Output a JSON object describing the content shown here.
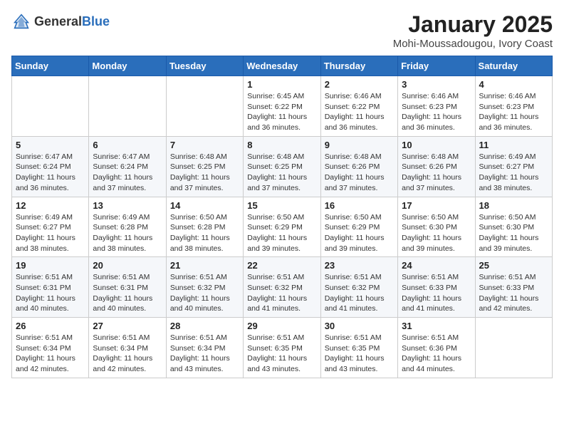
{
  "header": {
    "logo_general": "General",
    "logo_blue": "Blue",
    "title": "January 2025",
    "location": "Mohi-Moussadougou, Ivory Coast"
  },
  "weekdays": [
    "Sunday",
    "Monday",
    "Tuesday",
    "Wednesday",
    "Thursday",
    "Friday",
    "Saturday"
  ],
  "weeks": [
    [
      {
        "day": "",
        "info": ""
      },
      {
        "day": "",
        "info": ""
      },
      {
        "day": "",
        "info": ""
      },
      {
        "day": "1",
        "info": "Sunrise: 6:45 AM\nSunset: 6:22 PM\nDaylight: 11 hours and 36 minutes."
      },
      {
        "day": "2",
        "info": "Sunrise: 6:46 AM\nSunset: 6:22 PM\nDaylight: 11 hours and 36 minutes."
      },
      {
        "day": "3",
        "info": "Sunrise: 6:46 AM\nSunset: 6:23 PM\nDaylight: 11 hours and 36 minutes."
      },
      {
        "day": "4",
        "info": "Sunrise: 6:46 AM\nSunset: 6:23 PM\nDaylight: 11 hours and 36 minutes."
      }
    ],
    [
      {
        "day": "5",
        "info": "Sunrise: 6:47 AM\nSunset: 6:24 PM\nDaylight: 11 hours and 36 minutes."
      },
      {
        "day": "6",
        "info": "Sunrise: 6:47 AM\nSunset: 6:24 PM\nDaylight: 11 hours and 37 minutes."
      },
      {
        "day": "7",
        "info": "Sunrise: 6:48 AM\nSunset: 6:25 PM\nDaylight: 11 hours and 37 minutes."
      },
      {
        "day": "8",
        "info": "Sunrise: 6:48 AM\nSunset: 6:25 PM\nDaylight: 11 hours and 37 minutes."
      },
      {
        "day": "9",
        "info": "Sunrise: 6:48 AM\nSunset: 6:26 PM\nDaylight: 11 hours and 37 minutes."
      },
      {
        "day": "10",
        "info": "Sunrise: 6:48 AM\nSunset: 6:26 PM\nDaylight: 11 hours and 37 minutes."
      },
      {
        "day": "11",
        "info": "Sunrise: 6:49 AM\nSunset: 6:27 PM\nDaylight: 11 hours and 38 minutes."
      }
    ],
    [
      {
        "day": "12",
        "info": "Sunrise: 6:49 AM\nSunset: 6:27 PM\nDaylight: 11 hours and 38 minutes."
      },
      {
        "day": "13",
        "info": "Sunrise: 6:49 AM\nSunset: 6:28 PM\nDaylight: 11 hours and 38 minutes."
      },
      {
        "day": "14",
        "info": "Sunrise: 6:50 AM\nSunset: 6:28 PM\nDaylight: 11 hours and 38 minutes."
      },
      {
        "day": "15",
        "info": "Sunrise: 6:50 AM\nSunset: 6:29 PM\nDaylight: 11 hours and 39 minutes."
      },
      {
        "day": "16",
        "info": "Sunrise: 6:50 AM\nSunset: 6:29 PM\nDaylight: 11 hours and 39 minutes."
      },
      {
        "day": "17",
        "info": "Sunrise: 6:50 AM\nSunset: 6:30 PM\nDaylight: 11 hours and 39 minutes."
      },
      {
        "day": "18",
        "info": "Sunrise: 6:50 AM\nSunset: 6:30 PM\nDaylight: 11 hours and 39 minutes."
      }
    ],
    [
      {
        "day": "19",
        "info": "Sunrise: 6:51 AM\nSunset: 6:31 PM\nDaylight: 11 hours and 40 minutes."
      },
      {
        "day": "20",
        "info": "Sunrise: 6:51 AM\nSunset: 6:31 PM\nDaylight: 11 hours and 40 minutes."
      },
      {
        "day": "21",
        "info": "Sunrise: 6:51 AM\nSunset: 6:32 PM\nDaylight: 11 hours and 40 minutes."
      },
      {
        "day": "22",
        "info": "Sunrise: 6:51 AM\nSunset: 6:32 PM\nDaylight: 11 hours and 41 minutes."
      },
      {
        "day": "23",
        "info": "Sunrise: 6:51 AM\nSunset: 6:32 PM\nDaylight: 11 hours and 41 minutes."
      },
      {
        "day": "24",
        "info": "Sunrise: 6:51 AM\nSunset: 6:33 PM\nDaylight: 11 hours and 41 minutes."
      },
      {
        "day": "25",
        "info": "Sunrise: 6:51 AM\nSunset: 6:33 PM\nDaylight: 11 hours and 42 minutes."
      }
    ],
    [
      {
        "day": "26",
        "info": "Sunrise: 6:51 AM\nSunset: 6:34 PM\nDaylight: 11 hours and 42 minutes."
      },
      {
        "day": "27",
        "info": "Sunrise: 6:51 AM\nSunset: 6:34 PM\nDaylight: 11 hours and 42 minutes."
      },
      {
        "day": "28",
        "info": "Sunrise: 6:51 AM\nSunset: 6:34 PM\nDaylight: 11 hours and 43 minutes."
      },
      {
        "day": "29",
        "info": "Sunrise: 6:51 AM\nSunset: 6:35 PM\nDaylight: 11 hours and 43 minutes."
      },
      {
        "day": "30",
        "info": "Sunrise: 6:51 AM\nSunset: 6:35 PM\nDaylight: 11 hours and 43 minutes."
      },
      {
        "day": "31",
        "info": "Sunrise: 6:51 AM\nSunset: 6:36 PM\nDaylight: 11 hours and 44 minutes."
      },
      {
        "day": "",
        "info": ""
      }
    ]
  ]
}
